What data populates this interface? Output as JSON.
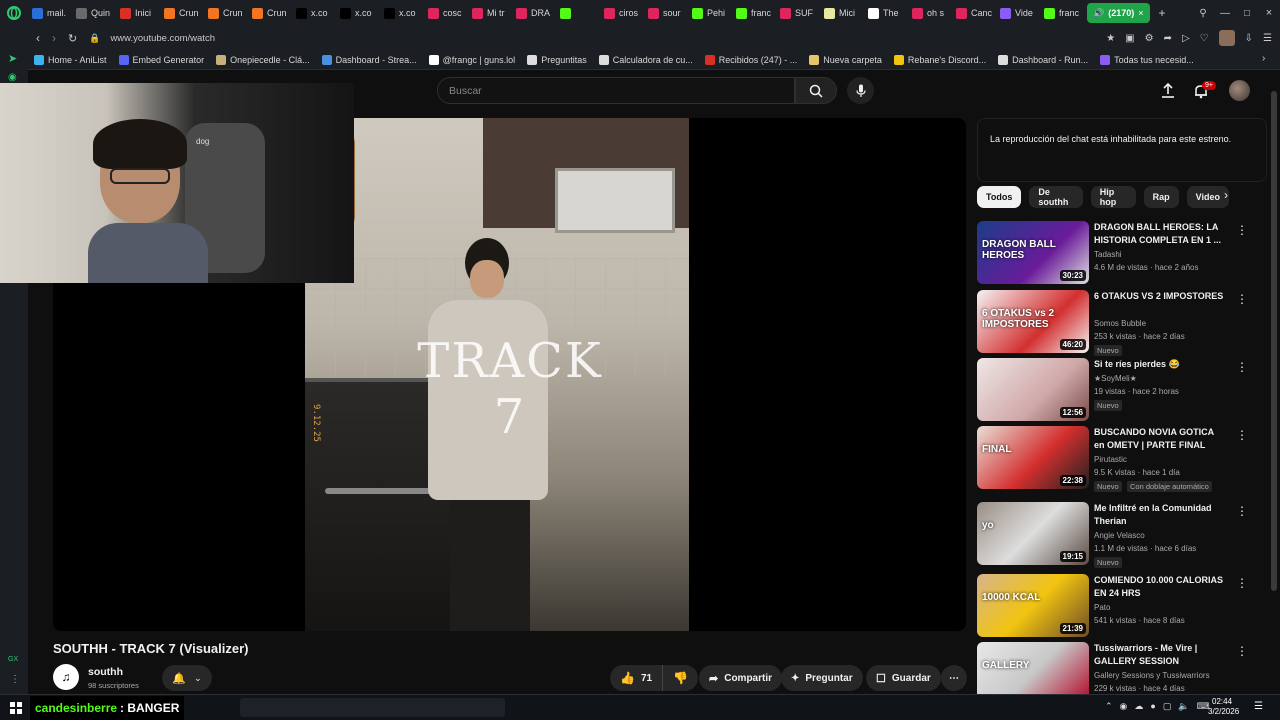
{
  "browser": {
    "tabs": [
      {
        "label": "mail.",
        "color": "#2a6fd8"
      },
      {
        "label": "Quin",
        "color": "#6a6a6a"
      },
      {
        "label": "Inici",
        "color": "#d93025"
      },
      {
        "label": "Crun",
        "color": "#f47521"
      },
      {
        "label": "Crun",
        "color": "#f47521"
      },
      {
        "label": "Crun",
        "color": "#f47521"
      },
      {
        "label": "x.co",
        "color": "#000000"
      },
      {
        "label": "x.co",
        "color": "#000000"
      },
      {
        "label": "x.co",
        "color": "#000000"
      },
      {
        "label": "cosc",
        "color": "#e0245e"
      },
      {
        "label": "Mi tr",
        "color": "#e0245e"
      },
      {
        "label": "DRA",
        "color": "#e0245e"
      },
      {
        "label": "",
        "color": "#53fc18"
      },
      {
        "label": "ciros",
        "color": "#e0245e"
      },
      {
        "label": "sour",
        "color": "#e0245e"
      },
      {
        "label": "Pehi",
        "color": "#53fc18"
      },
      {
        "label": "franc",
        "color": "#53fc18"
      },
      {
        "label": "SUF",
        "color": "#e0245e"
      },
      {
        "label": "Mici",
        "color": "#e8e8a0"
      },
      {
        "label": "The",
        "color": "#ffffff"
      },
      {
        "label": "oh s",
        "color": "#e0245e"
      },
      {
        "label": "Canc",
        "color": "#e0245e"
      },
      {
        "label": "Vide",
        "color": "#8b5cf6"
      },
      {
        "label": "franc",
        "color": "#53fc18"
      }
    ],
    "active_tab": {
      "label": "(2170)",
      "color": "#1fa44a"
    },
    "new_tab": "+",
    "url": "www.youtube.com/watch",
    "bookmarks": [
      {
        "label": "Home - AniList",
        "color": "#3db4f2"
      },
      {
        "label": "Embed Generator",
        "color": "#5865f2"
      },
      {
        "label": "Onepiecedle - Clá...",
        "color": "#c9b07a"
      },
      {
        "label": "Dashboard - Strea...",
        "color": "#4a90e2"
      },
      {
        "label": "@frangc | guns.lol",
        "color": "#ffffff"
      },
      {
        "label": "Preguntitas",
        "color": "#dddddd"
      },
      {
        "label": "Calculadora de cu...",
        "color": "#dddddd"
      },
      {
        "label": "Recibidos (247) - ...",
        "color": "#d93025"
      },
      {
        "label": "Nueva carpeta",
        "color": "#e8c46a"
      },
      {
        "label": "Rebane's Discord...",
        "color": "#f1c40f"
      },
      {
        "label": "Dashboard - Run...",
        "color": "#dddddd"
      },
      {
        "label": "Todas tus necesid...",
        "color": "#8b5cf6"
      }
    ]
  },
  "youtube": {
    "search_placeholder": "Buscar",
    "notif_count": "9+",
    "video_title": "SOUTHH - TRACK 7 (Visualizer)",
    "overlay_text": "TRACK 7",
    "date_stamp": "9.12.25",
    "channel": {
      "name": "southh",
      "subs": "98 suscriptores"
    },
    "actions": {
      "likes": "71",
      "share": "Compartir",
      "ask": "Preguntar",
      "save": "Guardar"
    },
    "chat_notice": "La reproducción del chat está inhabilitada para este estreno.",
    "chips": [
      "Todos",
      "De southh",
      "Hip hop",
      "Rap",
      "Video"
    ],
    "recommendations": [
      {
        "title": "DRAGON BALL HEROES: LA HISTORIA COMPLETA EN 1 ...",
        "channel": "Tadashi",
        "meta": "4.6 M de vistas · hace 2 años",
        "duration": "30:23",
        "badge": "",
        "thumb_text": "DRAGON BALL HEROES"
      },
      {
        "title": "6 OTAKUS VS 2 IMPOSTORES",
        "channel": "Somos Bubble",
        "meta": "253 k vistas · hace 2 días",
        "duration": "46:20",
        "badge": "Nuevo",
        "thumb_text": "6 OTAKUS vs 2 IMPOSTORES"
      },
      {
        "title": "Si te ríes pierdes 😂",
        "channel": "★SoyMeli★",
        "meta": "19 vistas · hace 2 horas",
        "duration": "12:56",
        "badge": "Nuevo",
        "thumb_text": ""
      },
      {
        "title": "BUSCANDO NOVIA GOTICA en OMETV | PARTE FINAL",
        "channel": "Pirutastic",
        "meta": "9.5 K vistas · hace 1 día",
        "duration": "22:38",
        "badge": "Nuevo",
        "extra": "Con doblaje automático",
        "thumb_text": "FINAL"
      },
      {
        "title": "Me Infiltré en la Comunidad Therian",
        "channel": "Angie Velasco",
        "meta": "1.1 M de vistas · hace 6 días",
        "duration": "19:15",
        "badge": "Nuevo",
        "thumb_text": "yo"
      },
      {
        "title": "COMIENDO 10.000 CALORIAS EN 24 HRS",
        "channel": "Pato",
        "meta": "541 k vistas · hace 8 días",
        "duration": "21:39",
        "badge": "",
        "thumb_text": "10000 KCAL"
      },
      {
        "title": "Tussiwarriors - Me Vire | GALLERY SESSION",
        "channel": "Gallery Sessions y Tussiwarriors",
        "meta": "229 k vistas · hace 4 días",
        "duration": "",
        "badge": "",
        "thumb_text": "GALLERY"
      }
    ]
  },
  "webcam_label": "dog",
  "chat_overlay": {
    "user": "candesinberre",
    "message": ": BANGER"
  },
  "taskbar": {
    "time": "02:44",
    "date": "3/2/2026",
    "side_label": "GX"
  },
  "colors": {
    "accent_red": "#ff0000",
    "green": "#53fc18"
  }
}
